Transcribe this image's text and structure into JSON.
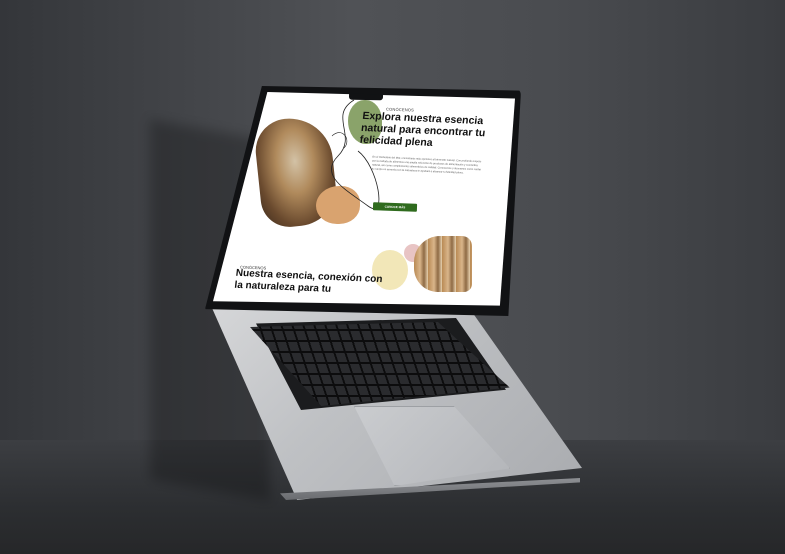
{
  "scene": {
    "description_free": true
  },
  "website": {
    "hero": {
      "eyebrow": "CONÓCENOS",
      "headline": "Explora nuestra esencia natural para encontrar tu felicidad plena",
      "paragraph": "En el Herbolario del Mar, encontrarás más opciones al bienestar natural. Con profundo respeto por la cuidada de alimentos una amplia selección de productos de alimentación y cosmética natural, así como complementos alimenticios de calidad. Conocemos y deseamos como cuidar tu cuerpo en armonía con la naturaleza te ayudará a alcanzar tu felicidad plena.",
      "cta_label": "CONOCE MÁS",
      "accent_color": "#2f6b1e"
    },
    "about": {
      "eyebrow": "CONÓCENOS",
      "headline": "Nuestra esencia, conexión con la naturaleza para tu"
    },
    "blob_colors": {
      "green": "#8aa36a",
      "tan": "#d9a36f",
      "yellow": "#f2e7b8",
      "pink": "#e8c4c4"
    }
  }
}
